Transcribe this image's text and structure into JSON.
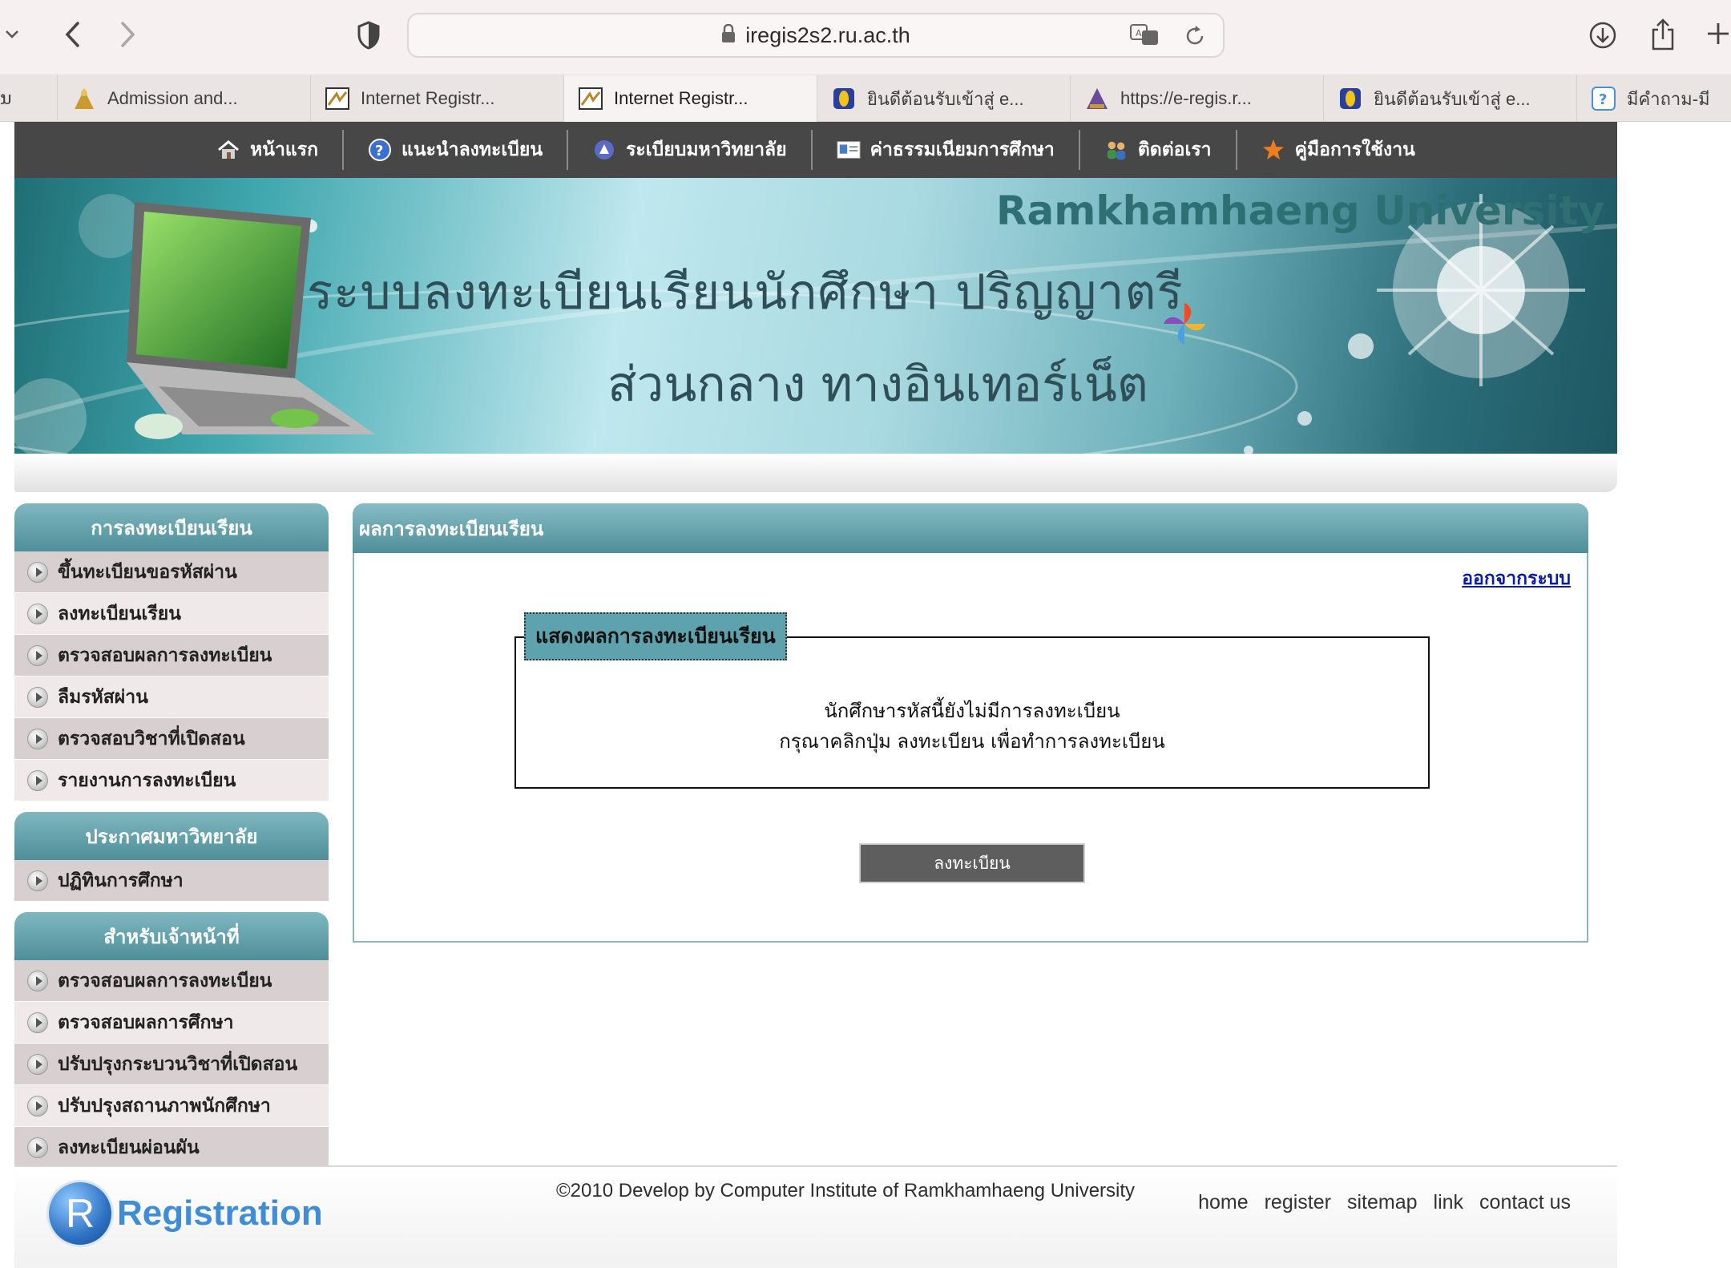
{
  "browser": {
    "url": "iregis2s2.ru.ac.th",
    "tabs": [
      {
        "label": "ນ"
      },
      {
        "label": "Admission and..."
      },
      {
        "label": "Internet Registr..."
      },
      {
        "label": "Internet Registr..."
      },
      {
        "label": "ยินดีต้อนรับเข้าสู่ e..."
      },
      {
        "label": "https://e-regis.r..."
      },
      {
        "label": "ยินดีต้อนรับเข้าสู่ e..."
      },
      {
        "label": "มีคำถาม-มี"
      }
    ],
    "active_tab": 3
  },
  "nav": {
    "items": [
      {
        "label": "หน้าแรก",
        "icon": "home-icon"
      },
      {
        "label": "แนะนำลงทะเบียน",
        "icon": "help-icon"
      },
      {
        "label": "ระเบียบมหาวิทยาลัย",
        "icon": "rules-icon"
      },
      {
        "label": "ค่าธรรมเนียมการศึกษา",
        "icon": "fee-card-icon"
      },
      {
        "label": "ติดต่อเรา",
        "icon": "people-icon"
      },
      {
        "label": "คู่มือการใช้งาน",
        "icon": "star-icon"
      }
    ]
  },
  "banner": {
    "title": "Ramkhamhaeng University",
    "line1": "ระบบลงทะเบียนเรียนนักศึกษา ปริญญาตรี",
    "line2": "ส่วนกลาง ทางอินเทอร์เน็ต"
  },
  "sidebar": {
    "sections": [
      {
        "title": "การลงทะเบียนเรียน",
        "items": [
          "ขึ้นทะเบียนขอรหัสผ่าน",
          "ลงทะเบียนเรียน",
          "ตรวจสอบผลการลงทะเบียน",
          "ลืมรหัสผ่าน",
          "ตรวจสอบวิชาที่เปิดสอน",
          "รายงานการลงทะเบียน"
        ]
      },
      {
        "title": "ประกาศมหาวิทยาลัย",
        "items": [
          "ปฏิทินการศึกษา"
        ]
      },
      {
        "title": "สำหรับเจ้าหน้าที่",
        "items": [
          "ตรวจสอบผลการลงทะเบียน",
          "ตรวจสอบผลการศึกษา",
          "ปรับปรุงกระบวนวิชาที่เปิดสอน",
          "ปรับปรุงสถานภาพนักศึกษา",
          "ลงทะเบียนผ่อนผัน"
        ]
      }
    ]
  },
  "main": {
    "title": "ผลการลงทะเบียนเรียน",
    "logout": "ออกจากระบบ",
    "legend": "แสดงผลการลงทะเบียนเรียน",
    "message_line1": "นักศึกษารหัสนี้ยังไม่มีการลงทะเบียน",
    "message_line2": "กรุณาคลิกปุ่ม ลงทะเบียน เพื่อทำการลงทะเบียน",
    "register_button": "ลงทะเบียน"
  },
  "footer": {
    "logo_letter": "R",
    "logo_text": "Registration",
    "copyright": "©2010 Develop by Computer Institute of Ramkhamhaeng University",
    "links": [
      "home",
      "register",
      "sitemap",
      "link",
      "contact us"
    ]
  }
}
